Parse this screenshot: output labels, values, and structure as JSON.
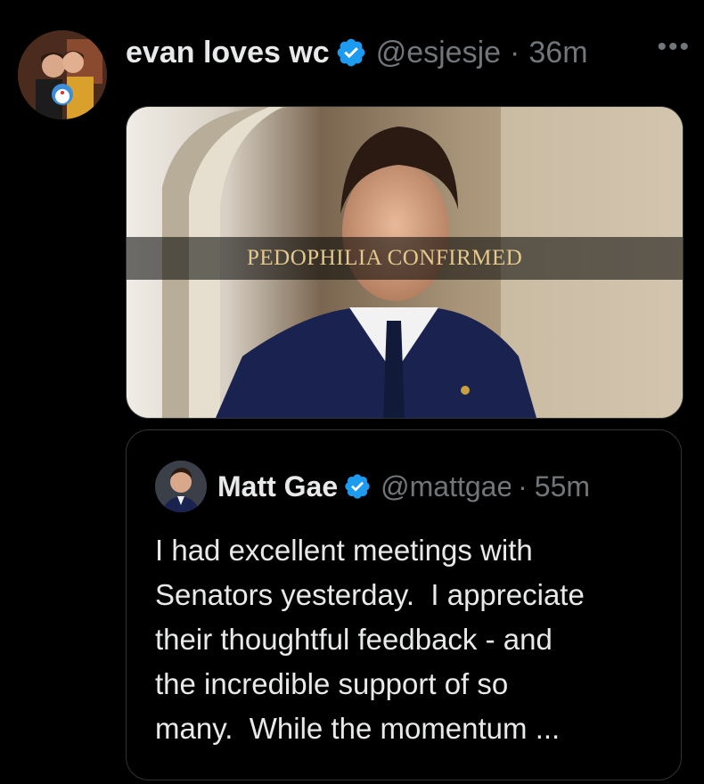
{
  "tweet": {
    "author_name": "evan loves wc",
    "verified_icon": "verified-badge-icon",
    "handle": "@esjesje",
    "separator": "·",
    "time": "36m",
    "more_label": "•••",
    "media": {
      "caption": "PEDOPHILIA CONFIRMED"
    }
  },
  "quoted_tweet": {
    "author_name": "Matt Gae",
    "handle": "@mattgae",
    "separator": "·",
    "time": "55m",
    "text": "I had excellent meetings with\nSenators yesterday.  I appreciate\ntheir thoughtful feedback - and\nthe incredible support of so\nmany.  While the momentum ..."
  },
  "colors": {
    "background": "#000000",
    "text_primary": "#e7e9ea",
    "text_secondary": "#71767b",
    "border": "#2f3336",
    "verified_blue": "#1d9bf0",
    "caption_gold": "#e3c98e"
  }
}
